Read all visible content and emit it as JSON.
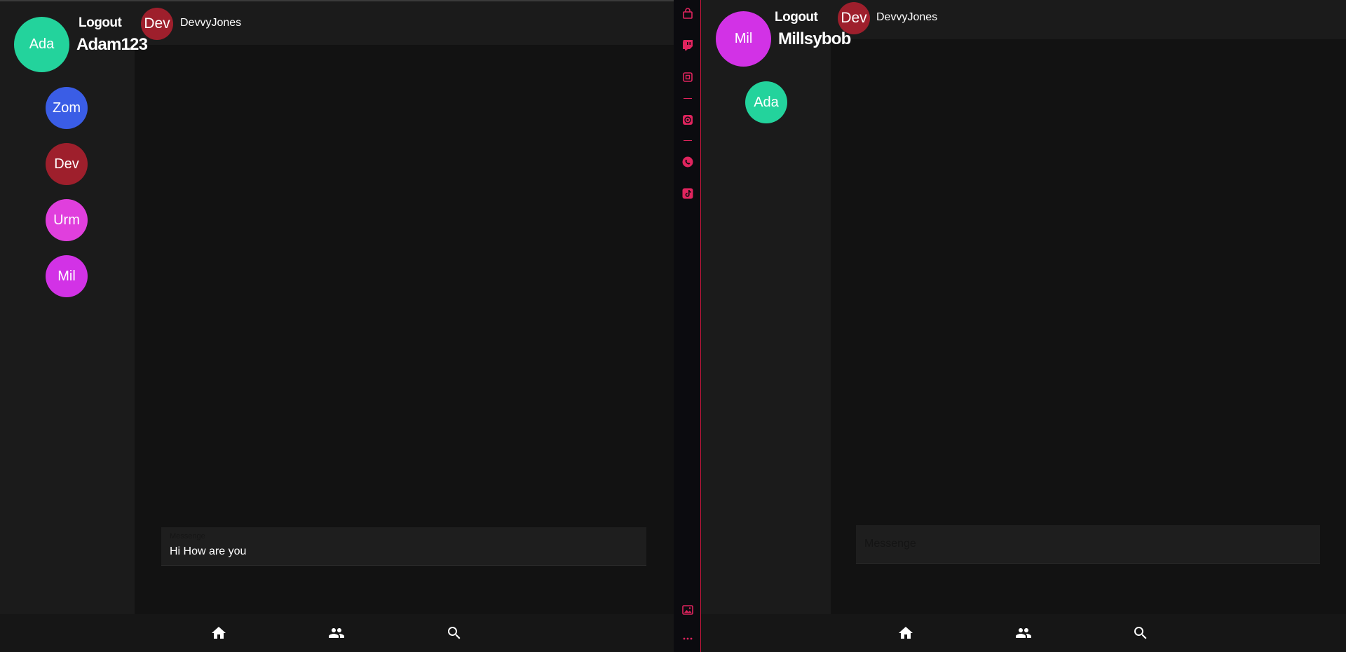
{
  "left_pane": {
    "header": {
      "avatar_text": "Ada",
      "avatar_color": "#23d39c",
      "logout_label": "Logout",
      "username": "Adam123",
      "chat_avatar_text": "Dev",
      "chat_avatar_color": "#9e1f2c",
      "chat_name": "DevvyJones"
    },
    "contacts": [
      {
        "text": "Zom",
        "color": "#3a5de6"
      },
      {
        "text": "Dev",
        "color": "#9e1f2c"
      },
      {
        "text": "Urm",
        "color": "#e03fdd"
      },
      {
        "text": "Mil",
        "color": "#d232e6"
      }
    ],
    "message": {
      "label": "Messenge",
      "value": "Hi How are you"
    }
  },
  "right_pane": {
    "header": {
      "avatar_text": "Mil",
      "avatar_color": "#d232e6",
      "logout_label": "Logout",
      "username": "Millsybob",
      "chat_avatar_text": "Dev",
      "chat_avatar_color": "#9e1f2c",
      "chat_name": "DevvyJones"
    },
    "contacts": [
      {
        "text": "Ada",
        "color": "#23d39c"
      }
    ],
    "message": {
      "placeholder": "Messenge"
    }
  },
  "bottom_nav": {
    "items": [
      "home-icon",
      "people-icon",
      "search-icon"
    ]
  },
  "side_strip": {
    "accent_color": "#e0245e",
    "icons": [
      "shopping-bag-icon",
      "twitch-icon",
      "chip-icon",
      "disc-icon",
      "whatsapp-icon",
      "tiktok-icon",
      "image-icon",
      "more-icon"
    ]
  }
}
